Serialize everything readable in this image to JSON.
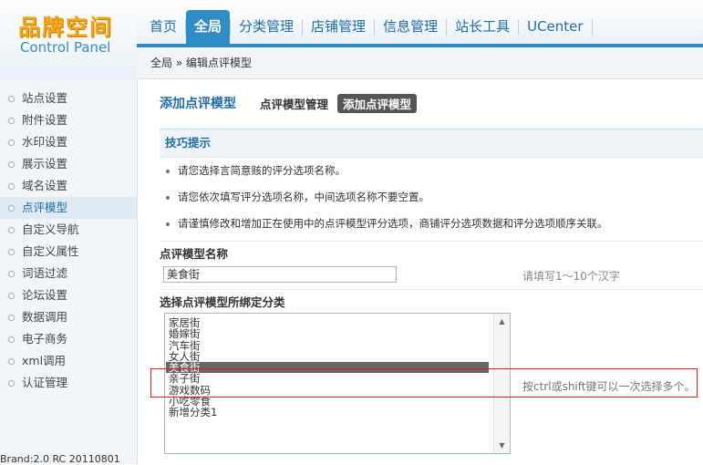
{
  "logo": {
    "title": "品牌空间",
    "subtitle": "Control Panel"
  },
  "topnav": [
    "首页",
    "全局",
    "分类管理",
    "店铺管理",
    "信息管理",
    "站长工具",
    "UCenter"
  ],
  "breadcrumb": "全局 » 编辑点评模型",
  "sidebar": {
    "items": [
      "站点设置",
      "附件设置",
      "水印设置",
      "展示设置",
      "域名设置",
      "点评模型",
      "自定义导航",
      "自定义属性",
      "词语过滤",
      "论坛设置",
      "数据调用",
      "电子商务",
      "xml调用",
      "认证管理"
    ],
    "active_index": 5,
    "brand": "Brand:2.0  RC 20110801"
  },
  "page": {
    "title": "添加点评模型",
    "link_manage": "点评模型管理",
    "btn_add": "添加点评模型"
  },
  "tips": {
    "heading": "技巧提示",
    "items": [
      "请您选择言简意赅的评分选项名称。",
      "请您依次填写评分选项名称，中间选项名称不要空置。",
      "请谨慎修改和增加正在使用中的点评模型评分选项，商铺评分选项数据和评分选项顺序关联。"
    ]
  },
  "form": {
    "name_label": "点评模型名称",
    "name_value": "美食街",
    "name_hint": "请填写1～10个汉字",
    "category_label": "选择点评模型所绑定分类",
    "category_hint": "按ctrl或shift键可以一次选择多个。",
    "options": [
      "家居街",
      "婚嫁街",
      "汽车街",
      "女人街",
      "美食街",
      "亲子街",
      "游戏数码",
      "小吃零食",
      "新增分类1"
    ],
    "selected_option": "美食街"
  },
  "colors": {
    "accent": "#2f8cc4",
    "logo": "#f5a414",
    "highlight_box": "#dd2222"
  }
}
